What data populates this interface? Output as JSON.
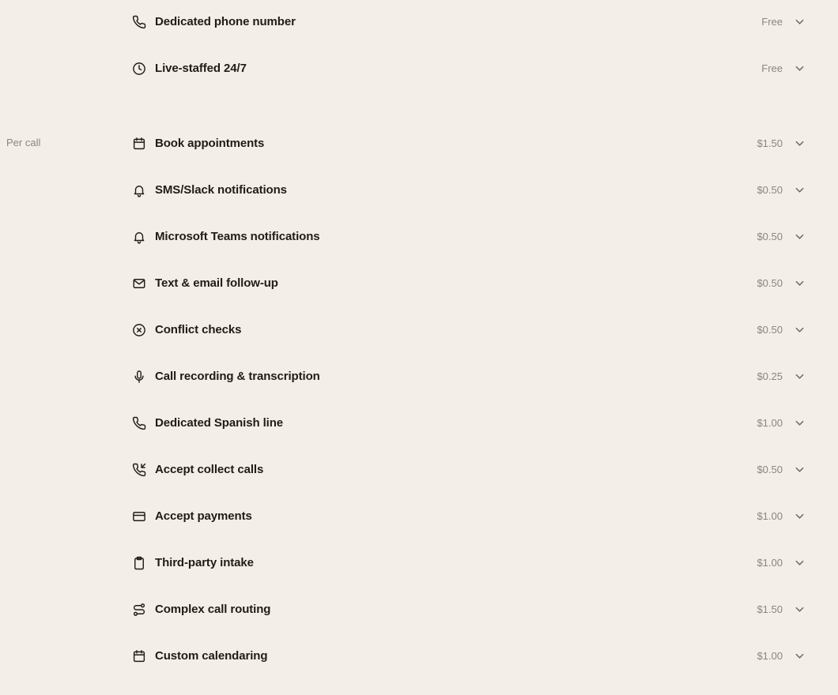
{
  "free_section": {
    "items": [
      {
        "label": "Dedicated phone number",
        "price": "Free",
        "icon": "phone-icon"
      },
      {
        "label": "Live-staffed 24/7",
        "price": "Free",
        "icon": "clock-icon"
      }
    ]
  },
  "per_call_section": {
    "title": "Per call",
    "items": [
      {
        "label": "Book appointments",
        "price": "$1.50",
        "icon": "calendar-icon"
      },
      {
        "label": "SMS/Slack notifications",
        "price": "$0.50",
        "icon": "bell-icon"
      },
      {
        "label": "Microsoft Teams notifications",
        "price": "$0.50",
        "icon": "bell-icon"
      },
      {
        "label": "Text & email follow-up",
        "price": "$0.50",
        "icon": "mail-icon"
      },
      {
        "label": "Conflict checks",
        "price": "$0.50",
        "icon": "x-circle-icon"
      },
      {
        "label": "Call recording & transcription",
        "price": "$0.25",
        "icon": "microphone-icon"
      },
      {
        "label": "Dedicated Spanish line",
        "price": "$1.00",
        "icon": "phone-icon"
      },
      {
        "label": "Accept collect calls",
        "price": "$0.50",
        "icon": "phone-incoming-icon"
      },
      {
        "label": "Accept payments",
        "price": "$1.00",
        "icon": "credit-card-icon"
      },
      {
        "label": "Third-party intake",
        "price": "$1.00",
        "icon": "clipboard-icon"
      },
      {
        "label": "Complex call routing",
        "price": "$1.50",
        "icon": "route-icon"
      },
      {
        "label": "Custom calendaring",
        "price": "$1.00",
        "icon": "calendar-icon"
      }
    ]
  },
  "colors": {
    "background": "#f3efe8",
    "text": "#1f1c18",
    "muted": "#8b857d"
  }
}
